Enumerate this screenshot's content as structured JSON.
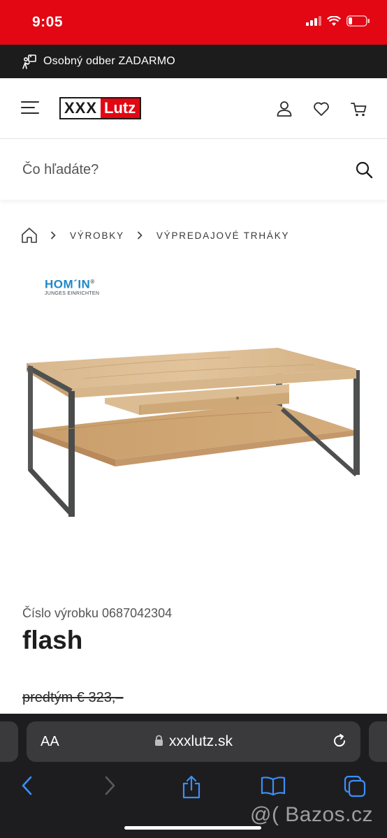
{
  "status_bar": {
    "time": "9:05"
  },
  "promo": {
    "text": "Osobný odber ZADARMO"
  },
  "header": {
    "logo_part1": "XXX",
    "logo_part2": "Lutz"
  },
  "search": {
    "placeholder": "Čo hľadáte?"
  },
  "breadcrumb": {
    "items": [
      "VÝROBKY",
      "VÝPREDAJOVÉ TRHÁKY"
    ]
  },
  "brand": {
    "name": "HOM´IN",
    "mark": "®",
    "tagline": "JUNGES EINRICHTEN"
  },
  "product": {
    "number_label": "Číslo výrobku 0687042304",
    "title": "flash",
    "old_price": "predtým € 323,–"
  },
  "browser": {
    "text_size": "AA",
    "url": "xxxlutz.sk"
  },
  "watermark": "@( Bazos.cz",
  "colors": {
    "brand_red": "#e30613",
    "promo_bg": "#1c1c1c",
    "safari_bg": "#1d1d1f",
    "hom_blue": "#1e88c8"
  }
}
